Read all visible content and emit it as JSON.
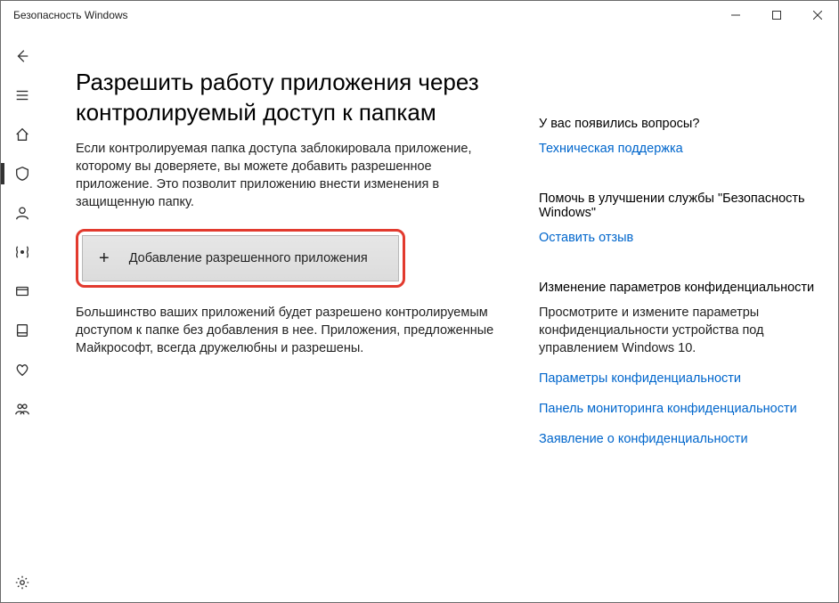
{
  "window": {
    "title": "Безопасность Windows"
  },
  "main": {
    "heading": "Разрешить работу приложения через контролируемый доступ к папкам",
    "intro": "Если контролируемая папка доступа заблокировала приложение, которому вы доверяете, вы можете добавить разрешенное приложение. Это позволит приложению внести изменения в защищенную папку.",
    "add_button": "Добавление разрешенного приложения",
    "note": "Большинство ваших приложений будет разрешено контролируемым доступом к папке без добавления в нее. Приложения, предложенные Майкрософт, всегда дружелюбны и разрешены."
  },
  "aside": {
    "questions": {
      "title": "У вас появились вопросы?",
      "link": "Техническая поддержка"
    },
    "feedback": {
      "title": "Помочь в улучшении службы \"Безопасность Windows\"",
      "link": "Оставить отзыв"
    },
    "privacy": {
      "title": "Изменение параметров конфиденциальности",
      "text": "Просмотрите и измените параметры конфиденциальности устройства под управлением Windows 10.",
      "link1": "Параметры конфиденциальности",
      "link2": "Панель мониторинга конфиденциальности",
      "link3": "Заявление о конфиденциальности"
    }
  }
}
